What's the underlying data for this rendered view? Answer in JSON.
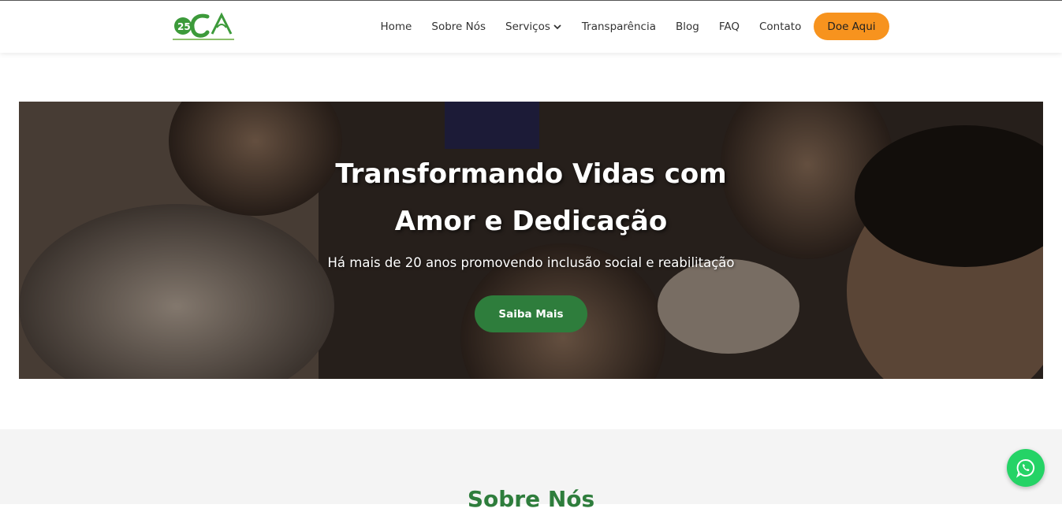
{
  "header": {
    "logo_alt": "25 OCA logo",
    "nav": [
      {
        "label": "Home"
      },
      {
        "label": "Sobre Nós"
      },
      {
        "label": "Serviços"
      },
      {
        "label": "Transparência"
      },
      {
        "label": "Blog"
      },
      {
        "label": "FAQ"
      },
      {
        "label": "Contato"
      }
    ],
    "donate_label": "Doe Aqui"
  },
  "hero": {
    "title_line1": "Transformando Vidas com",
    "title_line2": "Amor e Dedicação",
    "subtitle": "Há mais de 20 anos promovendo inclusão social e reabilitação",
    "cta_label": "Saiba Mais"
  },
  "about": {
    "title": "Sobre Nós"
  },
  "colors": {
    "brand_green": "#2e7d3c",
    "donate_orange": "#f7931e",
    "whatsapp_green": "#25d366"
  },
  "icons": {
    "dropdown": "chevron-down-icon",
    "chat": "whatsapp-icon"
  }
}
